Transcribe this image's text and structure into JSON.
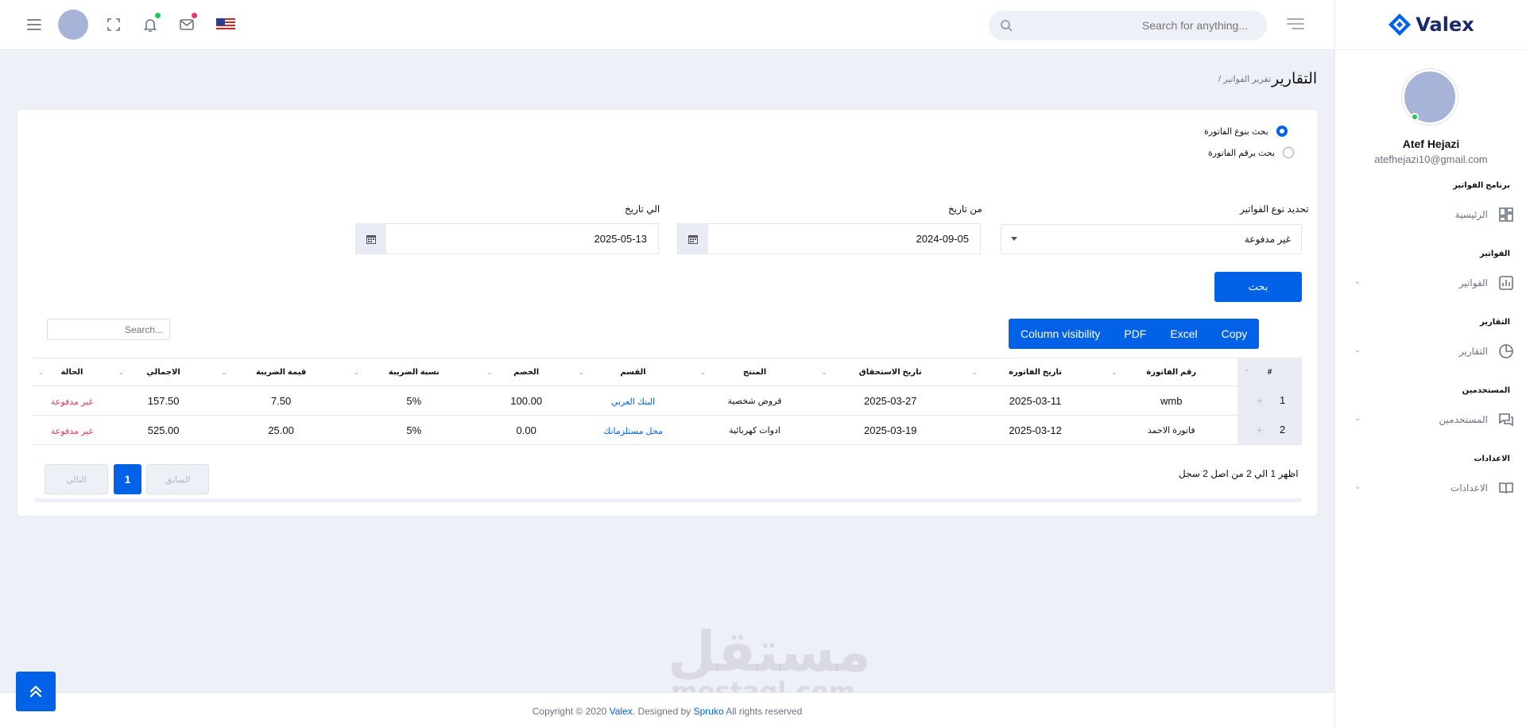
{
  "header": {
    "search_placeholder": "Search for anything...",
    "notif_dot_color": "#22c55e",
    "mail_dot_color": "#ee335e"
  },
  "brand": {
    "name": "Valex"
  },
  "profile": {
    "name": "Atef Hejazi",
    "email": "atefhejazi10@gmail.com"
  },
  "sidebar": {
    "sections": [
      {
        "title": "برنامج الفواتير",
        "item": "الرئيسية",
        "icon": "dashboard-icon",
        "has_chevron": false
      },
      {
        "title": "الفواتير",
        "item": "الفواتير",
        "icon": "bar-chart-icon",
        "has_chevron": true
      },
      {
        "title": "التقارير",
        "item": "التقارير",
        "icon": "pie-chart-icon",
        "has_chevron": true
      },
      {
        "title": "المستخدمين",
        "item": "المستخدمين",
        "icon": "chat-icon",
        "has_chevron": true
      },
      {
        "title": "الاعدادات",
        "item": "الاعدادات",
        "icon": "book-icon",
        "has_chevron": true
      }
    ]
  },
  "page": {
    "title": "التقارير",
    "breadcrumb": "/ تقرير الفواتير"
  },
  "form": {
    "radio_type_label": "بحث بنوع الفاتورة",
    "radio_number_label": "بحث برقم الفاتورة",
    "type_label": "تحديد نوع الفواتير",
    "type_value": "غير مدفوعة",
    "from_label": "من تاريخ",
    "from_value": "2024-09-05",
    "to_label": "الي تاريخ",
    "to_value": "2025-05-13",
    "search_button": "بحث"
  },
  "table_buttons": {
    "copy": "Copy",
    "excel": "Excel",
    "pdf": "PDF",
    "column_visibility": "Column visibility"
  },
  "table_search_placeholder": "Search...",
  "table": {
    "headers": [
      "#",
      "رقم الفاتورة",
      "تاريخ الفاتورة",
      "تاريخ الاستحقاق",
      "المنتج",
      "القسم",
      "الخصم",
      "نسبة الضريبة",
      "قيمة الضريبة",
      "الاجمالي",
      "الحالة"
    ],
    "rows": [
      {
        "num": "1",
        "invoice": "wmb",
        "invoice_date": "2025-03-11",
        "due_date": "2025-03-27",
        "product": "قروض شخصية",
        "section": "البنك العربي",
        "discount": "100.00",
        "tax_rate": "5%",
        "tax_value": "7.50",
        "total": "157.50",
        "status": "غير مدفوعة"
      },
      {
        "num": "2",
        "invoice": "فاتورة الاحمد",
        "invoice_date": "2025-03-12",
        "due_date": "2025-03-19",
        "product": "ادوات كهربائية",
        "section": "محل مستلزماتك",
        "discount": "0.00",
        "tax_rate": "5%",
        "tax_value": "25.00",
        "total": "525.00",
        "status": "غير مدفوعة"
      }
    ]
  },
  "pagination": {
    "info": "اظهر 1 الي 2 من اصل 2 سجل",
    "previous": "السابق",
    "current": "1",
    "next": "التالي"
  },
  "footer": {
    "prefix": "Copyright © 2020 ",
    "brand": "Valex",
    "mid": ". Designed by ",
    "designer": "Spruko",
    "suffix": " All rights reserved"
  },
  "watermark": {
    "arabic": "مستقل",
    "latin": "mostaql.com"
  },
  "colors": {
    "primary": "#0162e8",
    "unpaid": "#ee335e",
    "background": "#eef0f8"
  }
}
